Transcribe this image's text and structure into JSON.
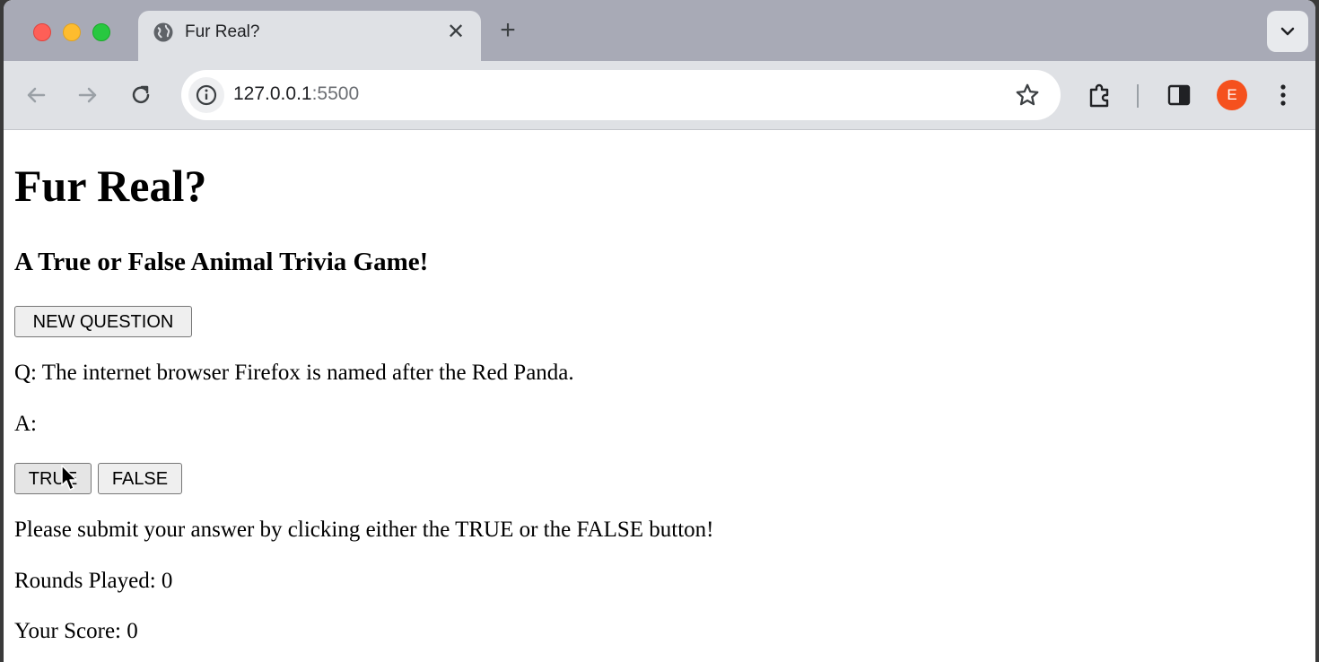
{
  "browser": {
    "tab_title": "Fur Real?",
    "tab_close": "✕",
    "new_tab": "+",
    "url_host": "127.0.0.1",
    "url_port": ":5500",
    "profile_initial": "E"
  },
  "page": {
    "title": "Fur Real?",
    "subtitle": "A True or False Animal Trivia Game!",
    "new_question_label": "NEW QUESTION",
    "question": "Q: The internet browser Firefox is named after the Red Panda.",
    "answer": "A:",
    "true_label": "TRUE",
    "false_label": "FALSE",
    "instruction": "Please submit your answer by clicking either the TRUE or the FALSE button!",
    "rounds": "Rounds Played: 0",
    "score": "Your Score: 0"
  },
  "colors": {
    "avatar": "#f5511e",
    "tabstrip": "#a8aab6",
    "toolbar": "#dfe1e5"
  }
}
